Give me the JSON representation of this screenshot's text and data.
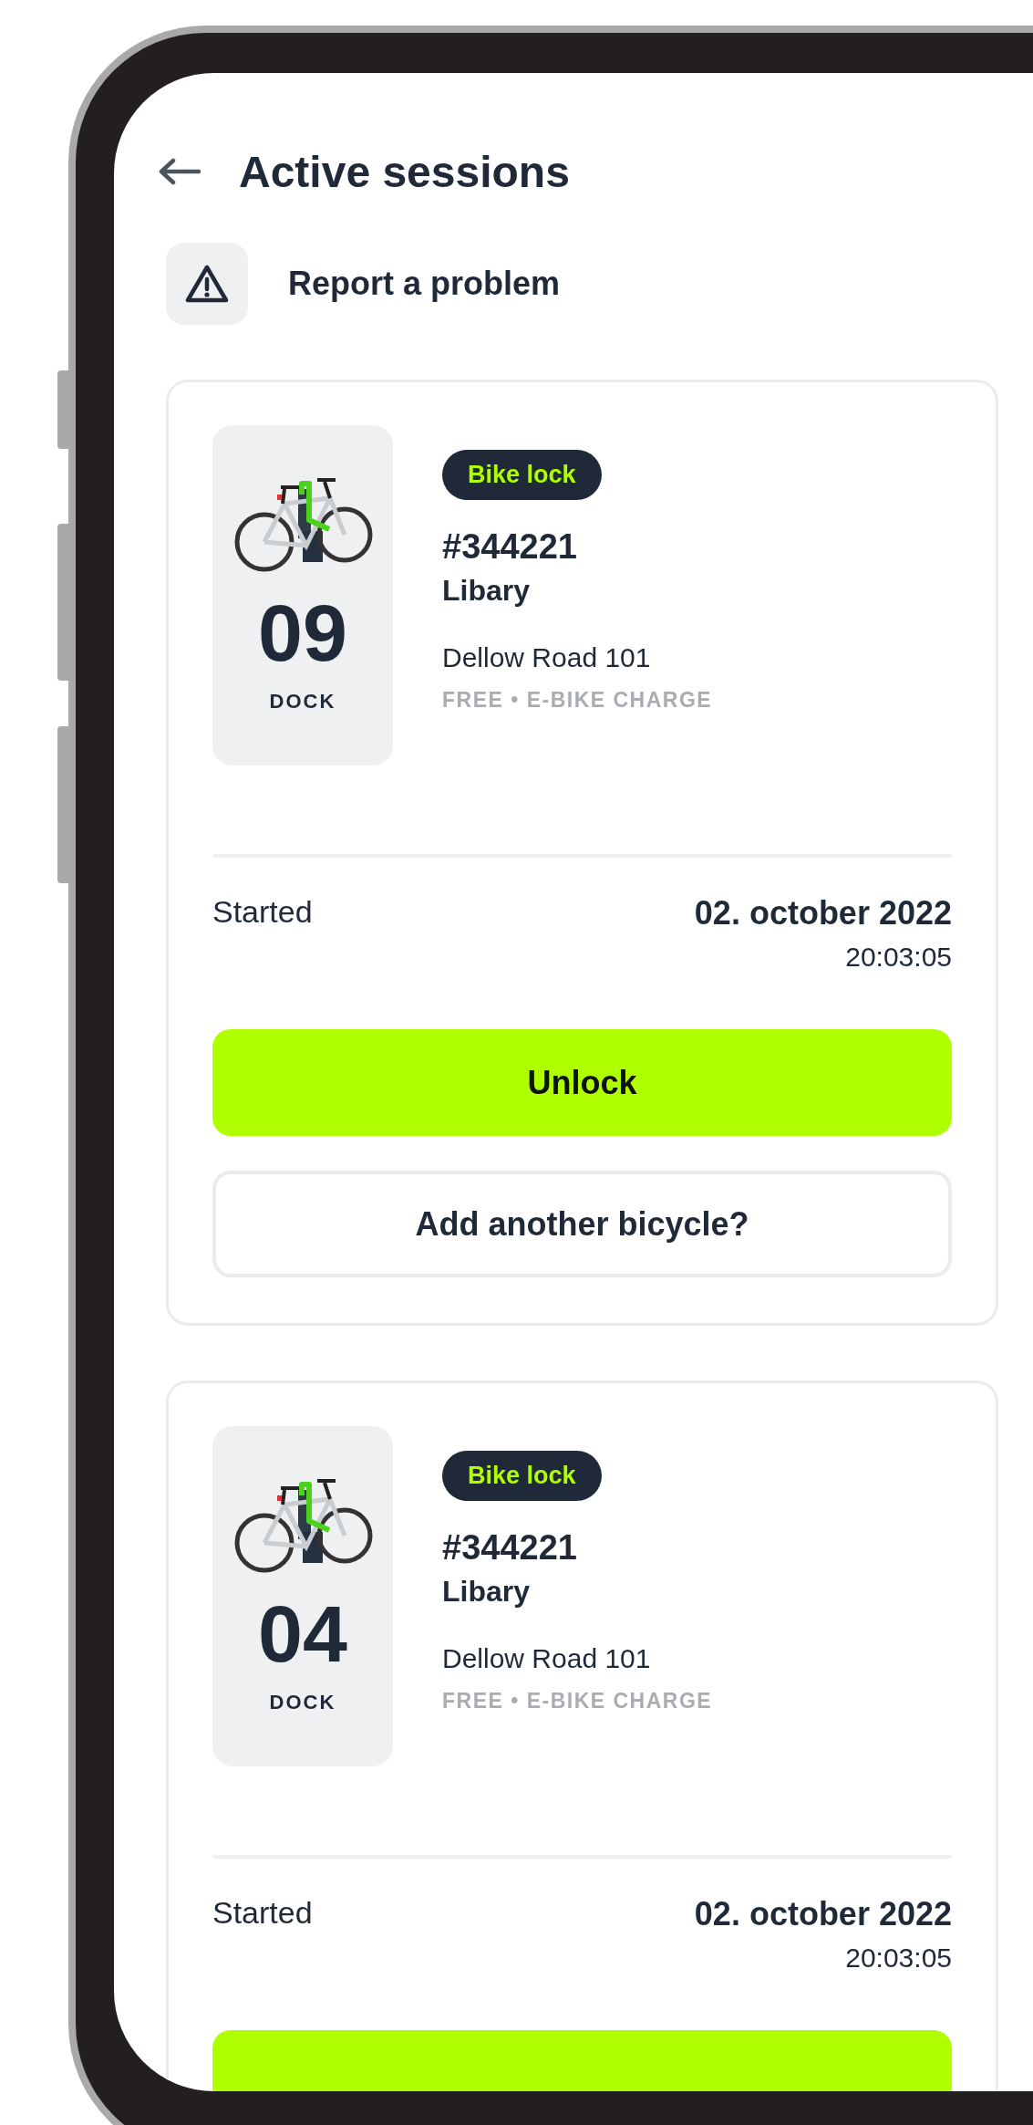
{
  "header": {
    "title": "Active sessions"
  },
  "report": {
    "label": "Report a problem"
  },
  "sessions": [
    {
      "dock_number": "09",
      "dock_label": "DOCK",
      "badge": "Bike lock",
      "id": "#344221",
      "name": "Libary",
      "address": "Dellow Road 101",
      "features": "FREE • E-BIKE CHARGE",
      "started_label": "Started",
      "date": "02. october 2022",
      "time": "20:03:05",
      "buttons": [
        {
          "kind": "primary",
          "label": "Unlock"
        },
        {
          "kind": "secondary",
          "label": "Add another bicycle?"
        }
      ]
    },
    {
      "dock_number": "04",
      "dock_label": "DOCK",
      "badge": "Bike lock",
      "id": "#344221",
      "name": "Libary",
      "address": "Dellow Road 101",
      "features": "FREE • E-BIKE CHARGE",
      "started_label": "Started",
      "date": "02. october 2022",
      "time": "20:03:05",
      "buttons": [
        {
          "kind": "primary"
        }
      ]
    }
  ]
}
